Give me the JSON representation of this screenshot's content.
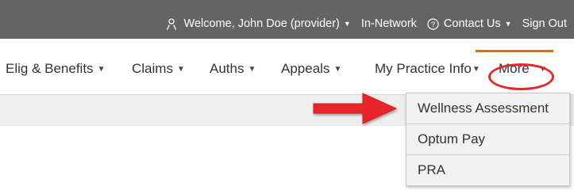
{
  "topbar": {
    "welcome_text": "Welcome, John Doe (provider)",
    "network_label": "In-Network",
    "contact_label": "Contact Us",
    "signout_label": "Sign Out",
    "icons": {
      "user": "user-icon",
      "help": "help-icon"
    }
  },
  "nav": {
    "items": [
      {
        "label": "Elig & Benefits"
      },
      {
        "label": "Claims"
      },
      {
        "label": "Auths"
      },
      {
        "label": "Appeals"
      },
      {
        "label": "My Practice Info"
      },
      {
        "label": "More"
      }
    ],
    "caret": "▼"
  },
  "more_menu": {
    "items": [
      {
        "label": "Wellness Assessment"
      },
      {
        "label": "Optum Pay"
      },
      {
        "label": "PRA"
      }
    ]
  },
  "colors": {
    "topbar_bg": "#646464",
    "accent_orange": "#e36c0a",
    "highlight_red": "#e8252a",
    "menu_bg": "#f2f2f2"
  }
}
